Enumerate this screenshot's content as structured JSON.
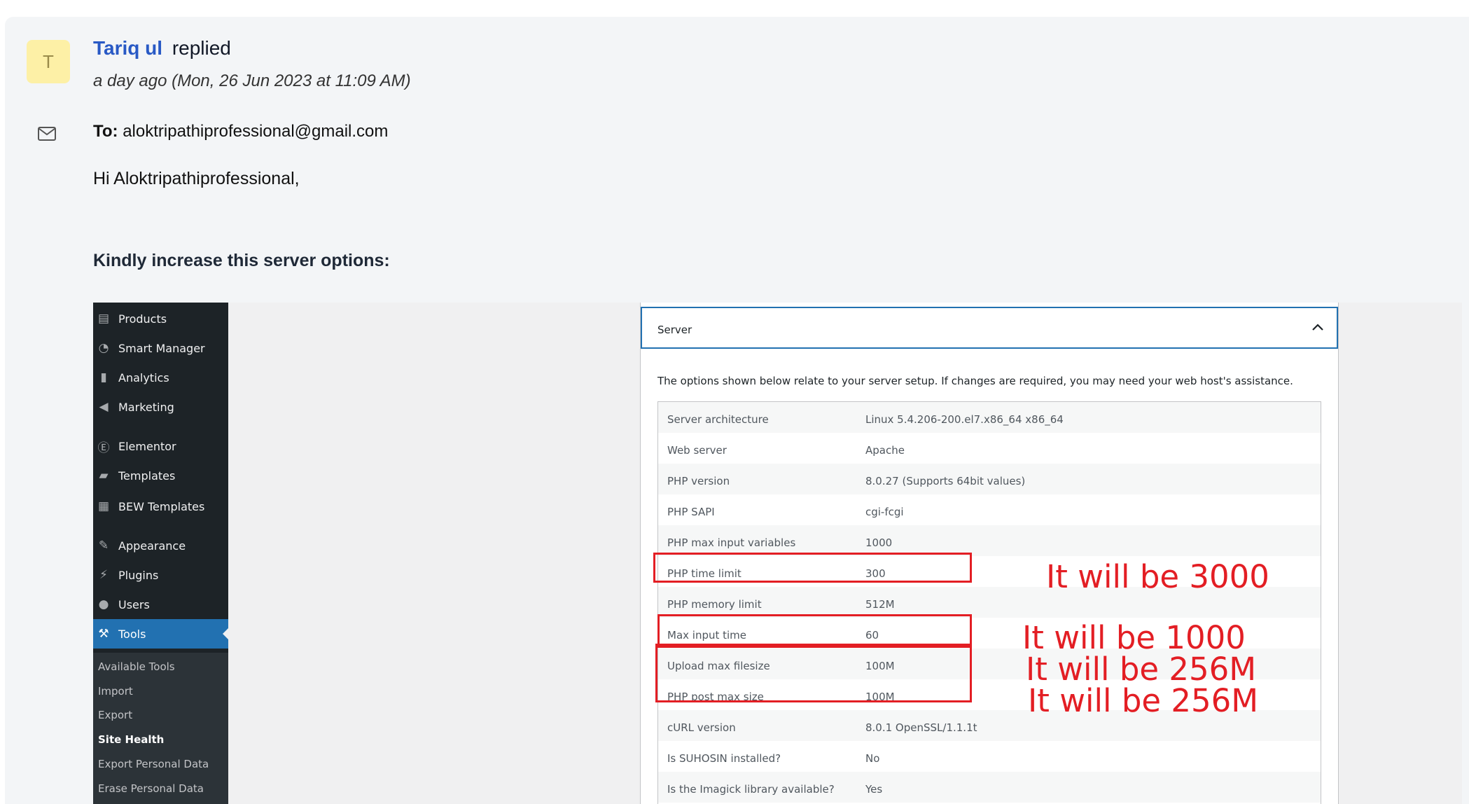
{
  "reply": {
    "avatar_initial": "T",
    "author_name": "Tariq ul",
    "action": "replied",
    "timestamp": "a day ago (Mon, 26 Jun 2023 at 11:09 AM)",
    "to_label": "To:",
    "to_email": "aloktripathiprofessional@gmail.com",
    "greeting": "Hi Aloktripathiprofessional,",
    "instruction": "Kindly increase this server options:"
  },
  "screenshot": {
    "menu": [
      {
        "label": "Products",
        "icon": "archive-icon"
      },
      {
        "label": "Smart Manager",
        "icon": "dashboard-icon"
      },
      {
        "label": "Analytics",
        "icon": "chart-bar-icon"
      },
      {
        "label": "Marketing",
        "icon": "megaphone-icon"
      },
      {
        "label": "Elementor",
        "icon": "elementor-icon"
      },
      {
        "label": "Templates",
        "icon": "folder-icon"
      },
      {
        "label": "BEW Templates",
        "icon": "grid-icon"
      },
      {
        "label": "Appearance",
        "icon": "paintbrush-icon"
      },
      {
        "label": "Plugins",
        "icon": "plug-icon"
      },
      {
        "label": "Users",
        "icon": "user-icon"
      },
      {
        "label": "Tools",
        "icon": "wrench-icon"
      }
    ],
    "submenu": [
      "Available Tools",
      "Import",
      "Export",
      "Site Health",
      "Export Personal Data",
      "Erase Personal Data"
    ],
    "panel_title": "Server",
    "intro": "The options shown below relate to your server setup. If changes are required, you may need your web host's assistance.",
    "rows": [
      {
        "key": "Server architecture",
        "value": "Linux 5.4.206-200.el7.x86_64 x86_64"
      },
      {
        "key": "Web server",
        "value": "Apache"
      },
      {
        "key": "PHP version",
        "value": "8.0.27 (Supports 64bit values)"
      },
      {
        "key": "PHP SAPI",
        "value": "cgi-fcgi"
      },
      {
        "key": "PHP max input variables",
        "value": "1000"
      },
      {
        "key": "PHP time limit",
        "value": "300"
      },
      {
        "key": "PHP memory limit",
        "value": "512M"
      },
      {
        "key": "Max input time",
        "value": "60"
      },
      {
        "key": "Upload max filesize",
        "value": "100M"
      },
      {
        "key": "PHP post max size",
        "value": "100M"
      },
      {
        "key": "cURL version",
        "value": "8.0.1 OpenSSL/1.1.1t"
      },
      {
        "key": "Is SUHOSIN installed?",
        "value": "No"
      },
      {
        "key": "Is the Imagick library available?",
        "value": "Yes"
      }
    ],
    "notes": [
      "It will be 3000",
      "It will be 1000",
      "It will be 256M",
      "It will be 256M"
    ],
    "annotation_color": "#e31e24",
    "active_color": "#2271b1"
  }
}
